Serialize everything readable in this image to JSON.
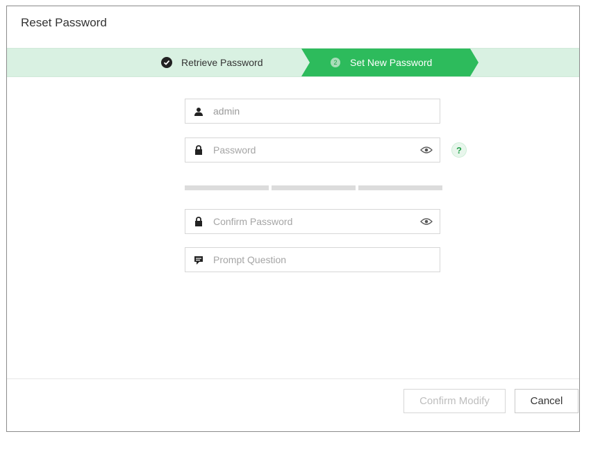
{
  "dialog": {
    "title": "Reset Password"
  },
  "steps": {
    "step1_label": "Retrieve Password",
    "step2_number": "2",
    "step2_label": "Set New Password"
  },
  "form": {
    "username_value": "admin",
    "password_placeholder": "Password",
    "confirm_placeholder": "Confirm Password",
    "prompt_placeholder": "Prompt Question",
    "help_symbol": "?"
  },
  "buttons": {
    "confirm_label": "Confirm Modify",
    "cancel_label": "Cancel"
  },
  "colors": {
    "accent": "#2dbb5c",
    "step_bg": "#d9f1e2"
  }
}
